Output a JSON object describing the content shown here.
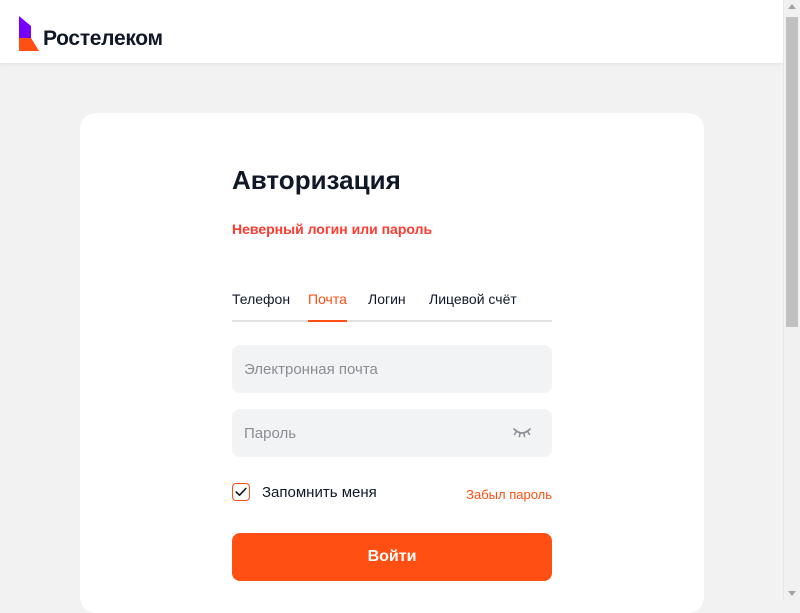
{
  "header": {
    "logo_text": "Ростелеком",
    "logo_colors": {
      "primary": "#7700ff",
      "accent": "#ff4f12"
    }
  },
  "auth": {
    "title": "Авторизация",
    "error": "Неверный логин или пароль",
    "tabs": [
      {
        "label": "Телефон",
        "active": false
      },
      {
        "label": "Почта",
        "active": true
      },
      {
        "label": "Логин",
        "active": false
      },
      {
        "label": "Лицевой счёт",
        "active": false
      }
    ],
    "email": {
      "placeholder": "Электронная почта",
      "value": ""
    },
    "password": {
      "placeholder": "Пароль",
      "value": "",
      "toggle_icon": "eye-closed-icon"
    },
    "remember": {
      "label": "Запомнить меня",
      "checked": true
    },
    "forgot_label": "Забыл пароль",
    "submit_label": "Войти"
  },
  "colors": {
    "accent": "#ff4f12",
    "error": "#ff3b30",
    "text": "#101828",
    "field_bg": "#f2f3f5",
    "page_bg": "#f2f2f2"
  }
}
